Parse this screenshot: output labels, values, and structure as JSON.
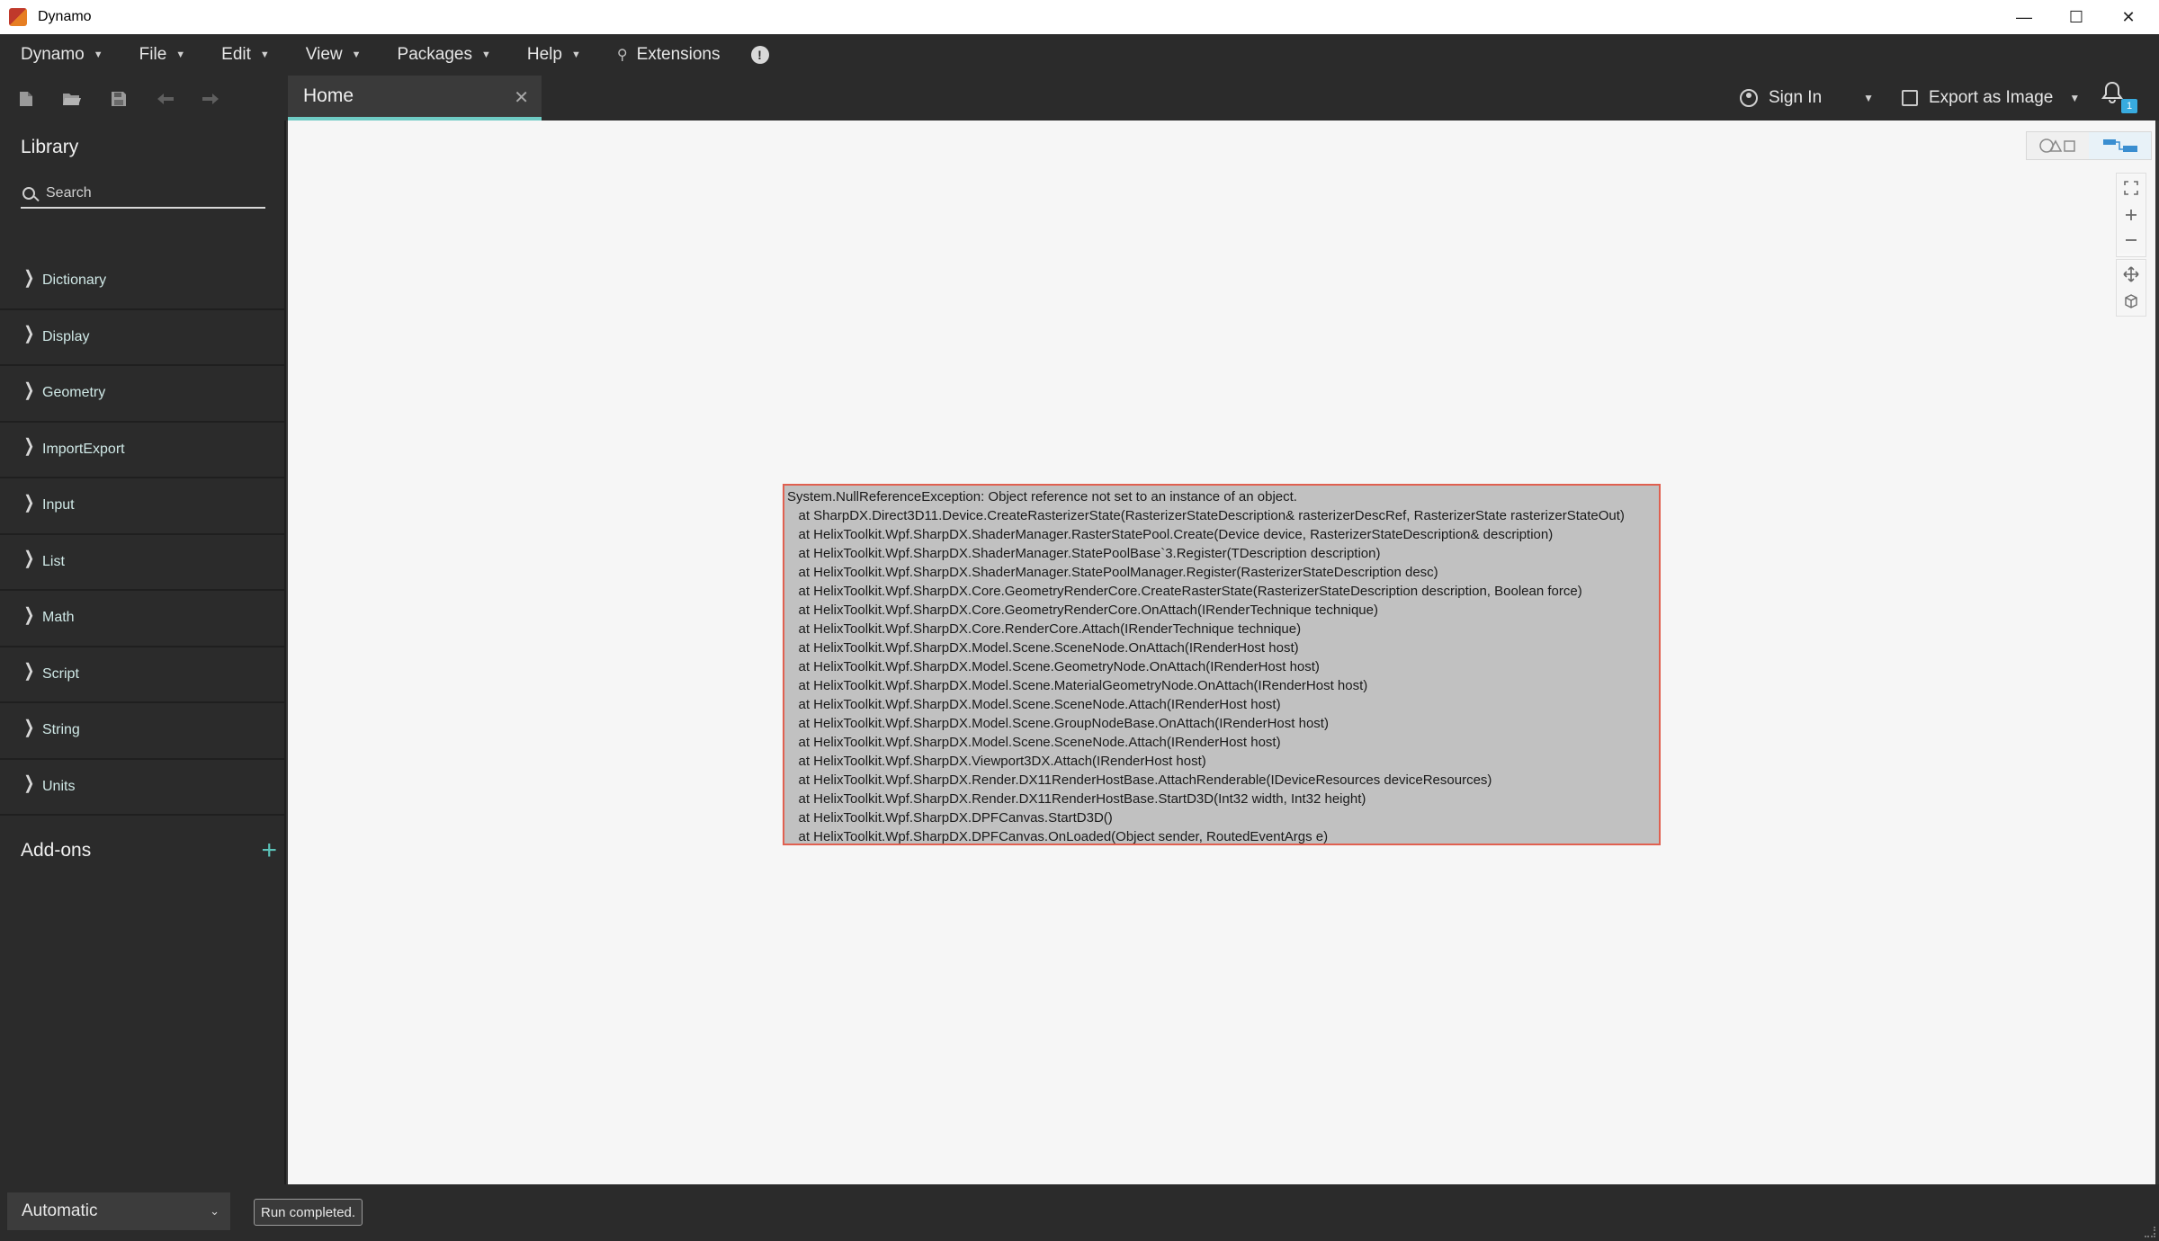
{
  "window": {
    "title": "Dynamo",
    "minimize_glyph": "—",
    "maximize_glyph": "☐",
    "close_glyph": "✕"
  },
  "menu": {
    "items": [
      {
        "label": "Dynamo",
        "icon": "chevron-down-icon"
      },
      {
        "label": "File",
        "icon": "chevron-down-icon"
      },
      {
        "label": "Edit",
        "icon": "chevron-down-icon"
      },
      {
        "label": "View",
        "icon": "chevron-down-icon"
      },
      {
        "label": "Packages",
        "icon": "chevron-down-icon"
      },
      {
        "label": "Help",
        "icon": "chevron-down-icon"
      }
    ],
    "extensions_label": "Extensions",
    "info_glyph": "!"
  },
  "toolbar": {
    "icons": [
      "new-file-icon",
      "open-folder-icon",
      "save-icon",
      "undo-icon",
      "redo-icon"
    ]
  },
  "tab": {
    "label": "Home",
    "close_glyph": "✕"
  },
  "account": {
    "sign_in_label": "Sign In",
    "export_label": "Export as Image",
    "notification_count": "1"
  },
  "library": {
    "title": "Library",
    "search_placeholder": "Search",
    "categories": [
      "Dictionary",
      "Display",
      "Geometry",
      "ImportExport",
      "Input",
      "List",
      "Math",
      "Script",
      "String",
      "Units"
    ],
    "addons_label": "Add-ons",
    "addons_plus": "+"
  },
  "canvas": {
    "view_modes": [
      "geometry-view-icon",
      "graph-view-icon"
    ],
    "nav_controls": [
      "zoom-to-fit-icon",
      "zoom-in-icon",
      "zoom-out-icon",
      "pan-icon",
      "orbit-icon"
    ],
    "error_lines": [
      "System.NullReferenceException: Object reference not set to an instance of an object.",
      "   at SharpDX.Direct3D11.Device.CreateRasterizerState(RasterizerStateDescription& rasterizerDescRef, RasterizerState rasterizerStateOut)",
      "   at HelixToolkit.Wpf.SharpDX.ShaderManager.RasterStatePool.Create(Device device, RasterizerStateDescription& description)",
      "   at HelixToolkit.Wpf.SharpDX.ShaderManager.StatePoolBase`3.Register(TDescription description)",
      "   at HelixToolkit.Wpf.SharpDX.ShaderManager.StatePoolManager.Register(RasterizerStateDescription desc)",
      "   at HelixToolkit.Wpf.SharpDX.Core.GeometryRenderCore.CreateRasterState(RasterizerStateDescription description, Boolean force)",
      "   at HelixToolkit.Wpf.SharpDX.Core.GeometryRenderCore.OnAttach(IRenderTechnique technique)",
      "   at HelixToolkit.Wpf.SharpDX.Core.RenderCore.Attach(IRenderTechnique technique)",
      "   at HelixToolkit.Wpf.SharpDX.Model.Scene.SceneNode.OnAttach(IRenderHost host)",
      "   at HelixToolkit.Wpf.SharpDX.Model.Scene.GeometryNode.OnAttach(IRenderHost host)",
      "   at HelixToolkit.Wpf.SharpDX.Model.Scene.MaterialGeometryNode.OnAttach(IRenderHost host)",
      "   at HelixToolkit.Wpf.SharpDX.Model.Scene.SceneNode.Attach(IRenderHost host)",
      "   at HelixToolkit.Wpf.SharpDX.Model.Scene.GroupNodeBase.OnAttach(IRenderHost host)",
      "   at HelixToolkit.Wpf.SharpDX.Model.Scene.SceneNode.Attach(IRenderHost host)",
      "   at HelixToolkit.Wpf.SharpDX.Viewport3DX.Attach(IRenderHost host)",
      "   at HelixToolkit.Wpf.SharpDX.Render.DX11RenderHostBase.AttachRenderable(IDeviceResources deviceResources)",
      "   at HelixToolkit.Wpf.SharpDX.Render.DX11RenderHostBase.StartD3D(Int32 width, Int32 height)",
      "   at HelixToolkit.Wpf.SharpDX.DPFCanvas.StartD3D()",
      "   at HelixToolkit.Wpf.SharpDX.DPFCanvas.OnLoaded(Object sender, RoutedEventArgs e)"
    ]
  },
  "status": {
    "run_mode": "Automatic",
    "run_status": "Run completed."
  },
  "colors": {
    "accent": "#6fcbc4",
    "error_border": "#e06050",
    "badge": "#38abdf"
  }
}
